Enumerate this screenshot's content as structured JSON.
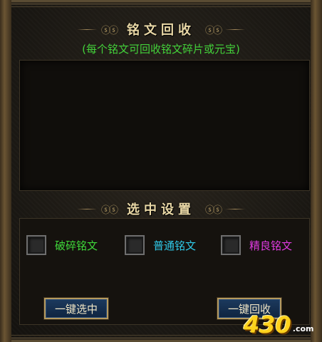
{
  "header": {
    "title": "铭文回收",
    "subtitle": "(每个铭文可回收铭文碎片或元宝)"
  },
  "settings": {
    "title": "选中设置",
    "options": [
      {
        "label": "破碎铭文",
        "color": "#3fd93a",
        "checked": false
      },
      {
        "label": "普通铭文",
        "color": "#2fc9e8",
        "checked": false
      },
      {
        "label": "精良铭文",
        "color": "#e03ae0",
        "checked": false
      }
    ]
  },
  "buttons": {
    "select_all": "一键选中",
    "recycle_all": "一键回收"
  },
  "watermark": {
    "number": "430",
    "domain": ".com"
  }
}
